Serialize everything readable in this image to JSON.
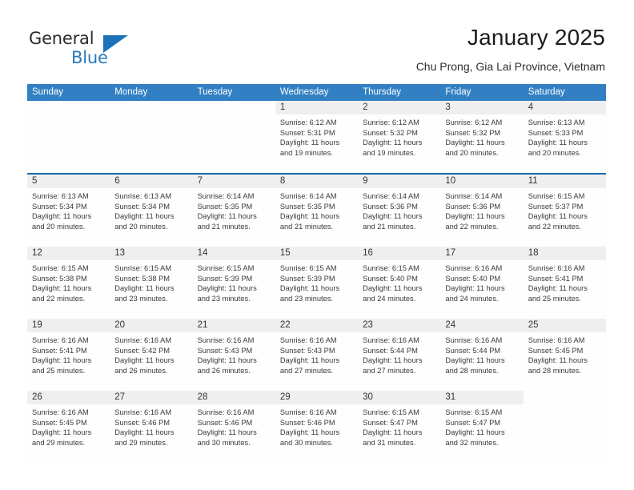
{
  "brand": {
    "name_part1": "General",
    "name_part2": "Blue",
    "triangle_color": "#1b72b8"
  },
  "header": {
    "title": "January 2025",
    "subtitle": "Chu Prong, Gia Lai Province, Vietnam"
  },
  "theme": {
    "header_blue": "#3280c3",
    "divider_blue": "#1b6bb0",
    "daynum_gray": "#efefef"
  },
  "weekdays": [
    "Sunday",
    "Monday",
    "Tuesday",
    "Wednesday",
    "Thursday",
    "Friday",
    "Saturday"
  ],
  "weeks": [
    [
      {
        "day": "",
        "empty": true
      },
      {
        "day": "",
        "empty": true
      },
      {
        "day": "",
        "empty": true
      },
      {
        "day": "1",
        "sunrise": "Sunrise: 6:12 AM",
        "sunset": "Sunset: 5:31 PM",
        "daylight1": "Daylight: 11 hours",
        "daylight2": "and 19 minutes."
      },
      {
        "day": "2",
        "sunrise": "Sunrise: 6:12 AM",
        "sunset": "Sunset: 5:32 PM",
        "daylight1": "Daylight: 11 hours",
        "daylight2": "and 19 minutes."
      },
      {
        "day": "3",
        "sunrise": "Sunrise: 6:12 AM",
        "sunset": "Sunset: 5:32 PM",
        "daylight1": "Daylight: 11 hours",
        "daylight2": "and 20 minutes."
      },
      {
        "day": "4",
        "sunrise": "Sunrise: 6:13 AM",
        "sunset": "Sunset: 5:33 PM",
        "daylight1": "Daylight: 11 hours",
        "daylight2": "and 20 minutes."
      }
    ],
    [
      {
        "day": "5",
        "sunrise": "Sunrise: 6:13 AM",
        "sunset": "Sunset: 5:34 PM",
        "daylight1": "Daylight: 11 hours",
        "daylight2": "and 20 minutes."
      },
      {
        "day": "6",
        "sunrise": "Sunrise: 6:13 AM",
        "sunset": "Sunset: 5:34 PM",
        "daylight1": "Daylight: 11 hours",
        "daylight2": "and 20 minutes."
      },
      {
        "day": "7",
        "sunrise": "Sunrise: 6:14 AM",
        "sunset": "Sunset: 5:35 PM",
        "daylight1": "Daylight: 11 hours",
        "daylight2": "and 21 minutes."
      },
      {
        "day": "8",
        "sunrise": "Sunrise: 6:14 AM",
        "sunset": "Sunset: 5:35 PM",
        "daylight1": "Daylight: 11 hours",
        "daylight2": "and 21 minutes."
      },
      {
        "day": "9",
        "sunrise": "Sunrise: 6:14 AM",
        "sunset": "Sunset: 5:36 PM",
        "daylight1": "Daylight: 11 hours",
        "daylight2": "and 21 minutes."
      },
      {
        "day": "10",
        "sunrise": "Sunrise: 6:14 AM",
        "sunset": "Sunset: 5:36 PM",
        "daylight1": "Daylight: 11 hours",
        "daylight2": "and 22 minutes."
      },
      {
        "day": "11",
        "sunrise": "Sunrise: 6:15 AM",
        "sunset": "Sunset: 5:37 PM",
        "daylight1": "Daylight: 11 hours",
        "daylight2": "and 22 minutes."
      }
    ],
    [
      {
        "day": "12",
        "sunrise": "Sunrise: 6:15 AM",
        "sunset": "Sunset: 5:38 PM",
        "daylight1": "Daylight: 11 hours",
        "daylight2": "and 22 minutes."
      },
      {
        "day": "13",
        "sunrise": "Sunrise: 6:15 AM",
        "sunset": "Sunset: 5:38 PM",
        "daylight1": "Daylight: 11 hours",
        "daylight2": "and 23 minutes."
      },
      {
        "day": "14",
        "sunrise": "Sunrise: 6:15 AM",
        "sunset": "Sunset: 5:39 PM",
        "daylight1": "Daylight: 11 hours",
        "daylight2": "and 23 minutes."
      },
      {
        "day": "15",
        "sunrise": "Sunrise: 6:15 AM",
        "sunset": "Sunset: 5:39 PM",
        "daylight1": "Daylight: 11 hours",
        "daylight2": "and 23 minutes."
      },
      {
        "day": "16",
        "sunrise": "Sunrise: 6:15 AM",
        "sunset": "Sunset: 5:40 PM",
        "daylight1": "Daylight: 11 hours",
        "daylight2": "and 24 minutes."
      },
      {
        "day": "17",
        "sunrise": "Sunrise: 6:16 AM",
        "sunset": "Sunset: 5:40 PM",
        "daylight1": "Daylight: 11 hours",
        "daylight2": "and 24 minutes."
      },
      {
        "day": "18",
        "sunrise": "Sunrise: 6:16 AM",
        "sunset": "Sunset: 5:41 PM",
        "daylight1": "Daylight: 11 hours",
        "daylight2": "and 25 minutes."
      }
    ],
    [
      {
        "day": "19",
        "sunrise": "Sunrise: 6:16 AM",
        "sunset": "Sunset: 5:41 PM",
        "daylight1": "Daylight: 11 hours",
        "daylight2": "and 25 minutes."
      },
      {
        "day": "20",
        "sunrise": "Sunrise: 6:16 AM",
        "sunset": "Sunset: 5:42 PM",
        "daylight1": "Daylight: 11 hours",
        "daylight2": "and 26 minutes."
      },
      {
        "day": "21",
        "sunrise": "Sunrise: 6:16 AM",
        "sunset": "Sunset: 5:43 PM",
        "daylight1": "Daylight: 11 hours",
        "daylight2": "and 26 minutes."
      },
      {
        "day": "22",
        "sunrise": "Sunrise: 6:16 AM",
        "sunset": "Sunset: 5:43 PM",
        "daylight1": "Daylight: 11 hours",
        "daylight2": "and 27 minutes."
      },
      {
        "day": "23",
        "sunrise": "Sunrise: 6:16 AM",
        "sunset": "Sunset: 5:44 PM",
        "daylight1": "Daylight: 11 hours",
        "daylight2": "and 27 minutes."
      },
      {
        "day": "24",
        "sunrise": "Sunrise: 6:16 AM",
        "sunset": "Sunset: 5:44 PM",
        "daylight1": "Daylight: 11 hours",
        "daylight2": "and 28 minutes."
      },
      {
        "day": "25",
        "sunrise": "Sunrise: 6:16 AM",
        "sunset": "Sunset: 5:45 PM",
        "daylight1": "Daylight: 11 hours",
        "daylight2": "and 28 minutes."
      }
    ],
    [
      {
        "day": "26",
        "sunrise": "Sunrise: 6:16 AM",
        "sunset": "Sunset: 5:45 PM",
        "daylight1": "Daylight: 11 hours",
        "daylight2": "and 29 minutes."
      },
      {
        "day": "27",
        "sunrise": "Sunrise: 6:16 AM",
        "sunset": "Sunset: 5:46 PM",
        "daylight1": "Daylight: 11 hours",
        "daylight2": "and 29 minutes."
      },
      {
        "day": "28",
        "sunrise": "Sunrise: 6:16 AM",
        "sunset": "Sunset: 5:46 PM",
        "daylight1": "Daylight: 11 hours",
        "daylight2": "and 30 minutes."
      },
      {
        "day": "29",
        "sunrise": "Sunrise: 6:16 AM",
        "sunset": "Sunset: 5:46 PM",
        "daylight1": "Daylight: 11 hours",
        "daylight2": "and 30 minutes."
      },
      {
        "day": "30",
        "sunrise": "Sunrise: 6:15 AM",
        "sunset": "Sunset: 5:47 PM",
        "daylight1": "Daylight: 11 hours",
        "daylight2": "and 31 minutes."
      },
      {
        "day": "31",
        "sunrise": "Sunrise: 6:15 AM",
        "sunset": "Sunset: 5:47 PM",
        "daylight1": "Daylight: 11 hours",
        "daylight2": "and 32 minutes."
      },
      {
        "day": "",
        "empty": true
      }
    ]
  ]
}
